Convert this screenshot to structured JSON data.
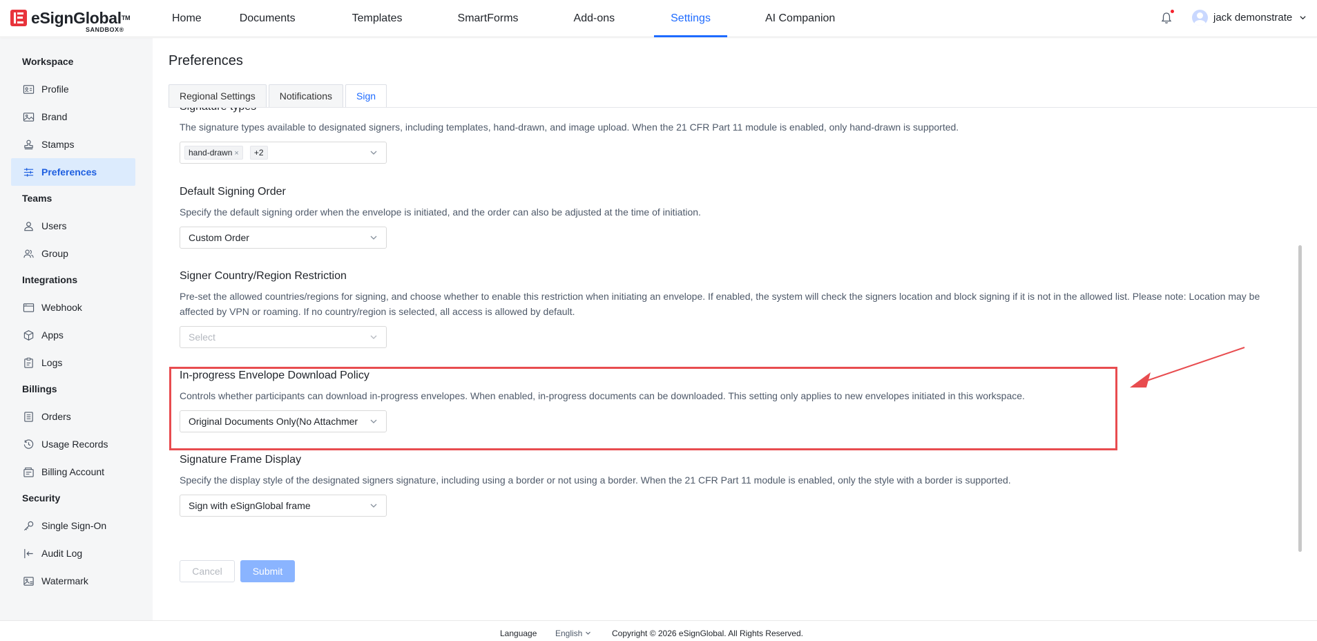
{
  "brand": {
    "name": "eSignGlobal",
    "tm": "TM",
    "sandbox": "SANDBOX®"
  },
  "nav": {
    "items": [
      {
        "label": "Home"
      },
      {
        "label": "Documents"
      },
      {
        "label": "Templates"
      },
      {
        "label": "SmartForms"
      },
      {
        "label": "Add-ons"
      },
      {
        "label": "Settings",
        "active": true
      },
      {
        "label": "AI Companion"
      }
    ],
    "user_name": "jack demonstrate"
  },
  "sidebar": {
    "groups": [
      {
        "title": "Workspace",
        "items": [
          {
            "label": "Profile",
            "icon": "id-card-icon"
          },
          {
            "label": "Brand",
            "icon": "image-icon"
          },
          {
            "label": "Stamps",
            "icon": "stamp-icon"
          },
          {
            "label": "Preferences",
            "icon": "sliders-icon",
            "active": true
          }
        ]
      },
      {
        "title": "Teams",
        "items": [
          {
            "label": "Users",
            "icon": "user-icon"
          },
          {
            "label": "Group",
            "icon": "group-icon"
          }
        ]
      },
      {
        "title": "Integrations",
        "items": [
          {
            "label": "Webhook",
            "icon": "browser-icon"
          },
          {
            "label": "Apps",
            "icon": "cube-icon"
          },
          {
            "label": "Logs",
            "icon": "clipboard-icon"
          }
        ]
      },
      {
        "title": "Billings",
        "items": [
          {
            "label": "Orders",
            "icon": "list-icon"
          },
          {
            "label": "Usage Records",
            "icon": "history-icon"
          },
          {
            "label": "Billing Account",
            "icon": "wallet-icon"
          }
        ]
      },
      {
        "title": "Security",
        "items": [
          {
            "label": "Single Sign-On",
            "icon": "key-icon"
          },
          {
            "label": "Audit Log",
            "icon": "login-icon"
          },
          {
            "label": "Watermark",
            "icon": "watermark-icon"
          }
        ]
      }
    ]
  },
  "page": {
    "title": "Preferences",
    "tabs": [
      {
        "label": "Regional Settings"
      },
      {
        "label": "Notifications"
      },
      {
        "label": "Sign",
        "active": true
      }
    ]
  },
  "sections": {
    "signature_types": {
      "title": "Signature types",
      "desc": "The signature types available to designated signers, including templates, hand-drawn, and image upload. When the 21 CFR Part 11 module is enabled, only hand-drawn is supported.",
      "tag": "hand-drawn",
      "more": "+2"
    },
    "signing_order": {
      "title": "Default Signing Order",
      "desc": "Specify the default signing order when the envelope is initiated, and the order can also be adjusted at the time of initiation.",
      "value": "Custom Order"
    },
    "country_restriction": {
      "title": "Signer Country/Region Restriction",
      "desc": "Pre-set the allowed countries/regions for signing, and choose whether to enable this restriction when initiating an envelope. If enabled, the system will check the signers location and block signing if it is not in the allowed list. Please note: Location may be affected by VPN or roaming. If no country/region is selected, all access is allowed by default.",
      "placeholder": "Select"
    },
    "download_policy": {
      "title": "In-progress Envelope Download Policy",
      "desc": "Controls whether participants can download in-progress envelopes. When enabled, in-progress documents can be downloaded. This setting only applies to new envelopes initiated in this workspace.",
      "value": "Original Documents Only(No Attachmer"
    },
    "frame_display": {
      "title": "Signature Frame Display",
      "desc": "Specify the display style of the designated signers signature, including using a border or not using a border. When the 21 CFR Part 11 module is enabled, only the style with a border is supported.",
      "value": "Sign with eSignGlobal frame"
    }
  },
  "buttons": {
    "cancel": "Cancel",
    "submit": "Submit"
  },
  "footer": {
    "language_label": "Language",
    "language_value": "English",
    "copyright": "Copyright © 2026 eSignGlobal. All Rights Reserved."
  },
  "colors": {
    "accent": "#1e6bff",
    "highlight": "#e84c4f",
    "annotation_arrow": "#e84c4f"
  }
}
